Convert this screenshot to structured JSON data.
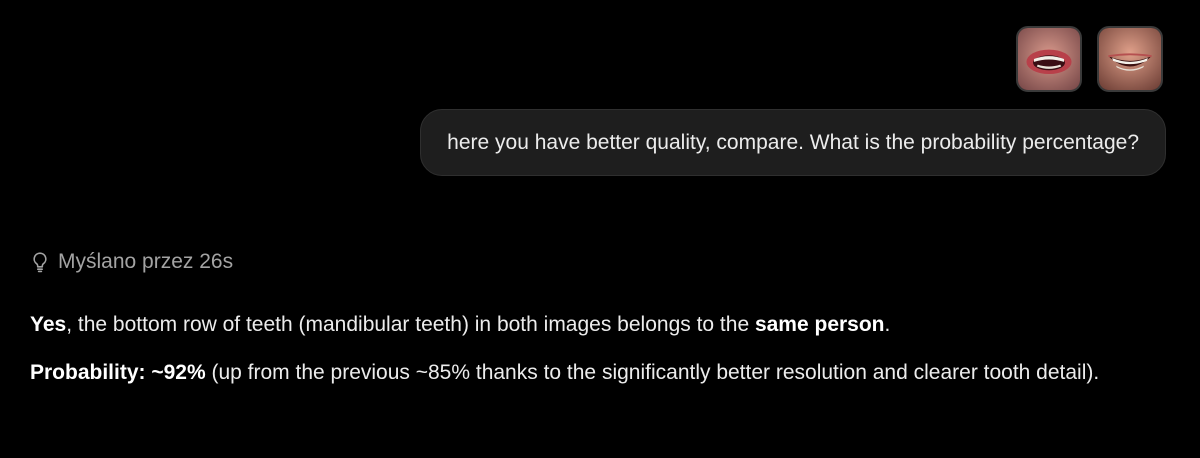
{
  "attachments": [
    {
      "icon": "mouth-photo-1-icon"
    },
    {
      "icon": "mouth-photo-2-icon"
    }
  ],
  "user_message": "here you have better quality, compare. What is the probability percentage?",
  "thought": {
    "icon": "lightbulb-icon",
    "label": "Myślano przez 26s"
  },
  "reply": {
    "p1": {
      "bold1": "Yes",
      "text1": ", the bottom row of teeth (mandibular teeth) in both images belongs to the ",
      "bold2": "same person",
      "text2": "."
    },
    "p2": {
      "bold1": "Probability: ~92%",
      "text1": " (up from the previous ~85% thanks to the significantly better resolution and clearer tooth detail)."
    }
  },
  "colors": {
    "background": "#000000",
    "bubble": "#1e1e1e",
    "text": "#ececec",
    "muted": "#a3a3a3"
  }
}
